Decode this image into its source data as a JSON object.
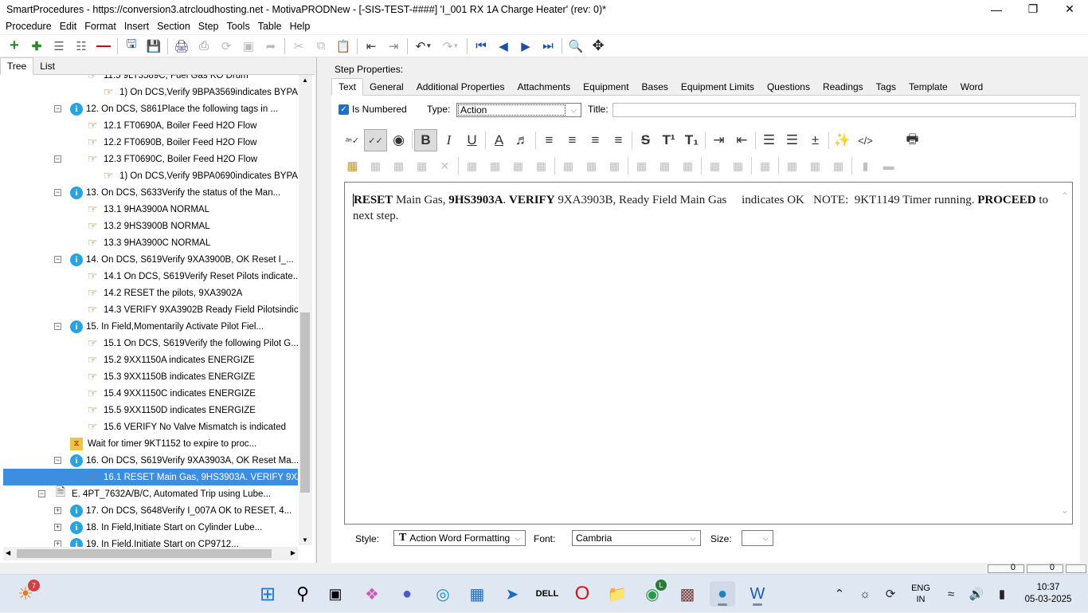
{
  "window": {
    "title": "SmartProcedures - https://conversion3.atrcloudhosting.net - MotivaPRODNew - [-SIS-TEST-####] 'I_001 RX 1A Charge Heater' (rev: 0)*"
  },
  "menubar": [
    "Procedure",
    "Edit",
    "Format",
    "Insert",
    "Section",
    "Step",
    "Tools",
    "Table",
    "Help"
  ],
  "left_tabs": [
    "Tree",
    "List"
  ],
  "tree": [
    {
      "label": "11.5 9LT3589C, Fuel Gas KO Drum",
      "icon": "hand-icon"
    },
    {
      "label": "1) On DCS,Verify  9BPA3569indicates  BYPA...",
      "icon": "hand-icon"
    },
    {
      "label": "12. On DCS, S861Place the following tags in ...",
      "icon": "info-icon"
    },
    {
      "label": "12.1 FT0690A, Boiler Feed H2O Flow",
      "icon": "hand-icon"
    },
    {
      "label": "12.2 FT0690B, Boiler Feed H2O Flow",
      "icon": "hand-icon"
    },
    {
      "label": "12.3 FT0690C, Boiler Feed H2O Flow",
      "icon": "hand-icon"
    },
    {
      "label": "1) On DCS,Verify  9BPA0690indicates  BYPA...",
      "icon": "hand-icon"
    },
    {
      "label": "13. On DCS, S633Verify the status of the Man...",
      "icon": "info-icon"
    },
    {
      "label": "13.1 9HA3900A        NORMAL",
      "icon": "hand-icon"
    },
    {
      "label": "13.2 9HS3900B        NORMAL",
      "icon": "hand-icon"
    },
    {
      "label": "13.3 9HA3900C        NORMAL",
      "icon": "hand-icon"
    },
    {
      "label": "14. On DCS, S619Verify 9XA3900B, OK Reset I_...",
      "icon": "info-icon"
    },
    {
      "label": "14.1 On DCS, S619Verify Reset Pilots indicate...",
      "icon": "hand-icon"
    },
    {
      "label": "14.2 RESET the pilots, 9XA3902A",
      "icon": "hand-icon"
    },
    {
      "label": "14.3  VERIFY  9XA3902B  Ready  Field  Pilotsindic...",
      "icon": "hand-icon"
    },
    {
      "label": "15. In Field,Momentarily Activate Pilot Fiel...",
      "icon": "info-icon"
    },
    {
      "label": "15.1 On DCS, S619Verify the following Pilot G...",
      "icon": "hand-icon"
    },
    {
      "label": "15.2 9XX1150A indicates ENERGIZE",
      "icon": "hand-icon"
    },
    {
      "label": "15.3 9XX1150B indicates ENERGIZE",
      "icon": "hand-icon"
    },
    {
      "label": "15.4 9XX1150C indicates ENERGIZE",
      "icon": "hand-icon"
    },
    {
      "label": "15.5 9XX1150D indicates ENERGIZE",
      "icon": "hand-icon"
    },
    {
      "label": "15.6 VERIFY No Valve Mismatch is indicated",
      "icon": "hand-icon"
    },
    {
      "label": "Wait for timer 9KT1152 to expire to proc...",
      "icon": "timer-icon"
    },
    {
      "label": "16. On DCS, S619Verify 9XA3903A, OK Reset Ma...",
      "icon": "info-icon"
    },
    {
      "label": "16.1  RESET Main Gas,  9HS3903A.  VERIFY  9XA...",
      "icon": "hand-icon"
    },
    {
      "label": "E. 4PT_7632A/B/C, Automated Trip using Lube...",
      "icon": "document-icon"
    },
    {
      "label": "17. On DCS, S648Verify I_007A OK to RESET, 4...",
      "icon": "info-icon"
    },
    {
      "label": "18. In Field,Initiate Start on Cylinder Lube...",
      "icon": "info-icon"
    },
    {
      "label": "19. In Field,Initiate Start on CP9712...",
      "icon": "info-icon"
    }
  ],
  "step_properties": {
    "label": "Step Properties:",
    "tabs": [
      "Text",
      "General",
      "Additional Properties",
      "Attachments",
      "Equipment",
      "Bases",
      "Equipment Limits",
      "Questions",
      "Readings",
      "Tags",
      "Template",
      "Word"
    ],
    "is_numbered_label": "Is Numbered",
    "is_numbered": true,
    "type_label": "Type:",
    "type_value": "Action",
    "title_label": "Title:",
    "title_value": ""
  },
  "editor": {
    "segments": [
      {
        "text": "RESET",
        "bold": true
      },
      {
        "text": " Main Gas, ",
        "bold": false
      },
      {
        "text": "9HS3903A",
        "bold": true
      },
      {
        "text": ". ",
        "bold": false
      },
      {
        "text": "VERIFY",
        "bold": true
      },
      {
        "text": " 9XA3903B, Ready Field Main Gas     indicates OK   NOTE:  9KT1149 Timer running. ",
        "bold": false
      },
      {
        "text": "PROCEED",
        "bold": true
      },
      {
        "text": " to next step.",
        "bold": false
      }
    ]
  },
  "bottom": {
    "style_label": "Style:",
    "style_value": "Action Word Formatting",
    "font_label": "Font:",
    "font_value": "Cambria",
    "size_label": "Size:",
    "size_value": ""
  },
  "status": {
    "box1": "0",
    "box2": "0"
  },
  "taskbar": {
    "badge": "7",
    "chrome_badge": "L",
    "lang_line1": "ENG",
    "lang_line2": "IN",
    "time": "10:37",
    "date": "05-03-2025"
  }
}
